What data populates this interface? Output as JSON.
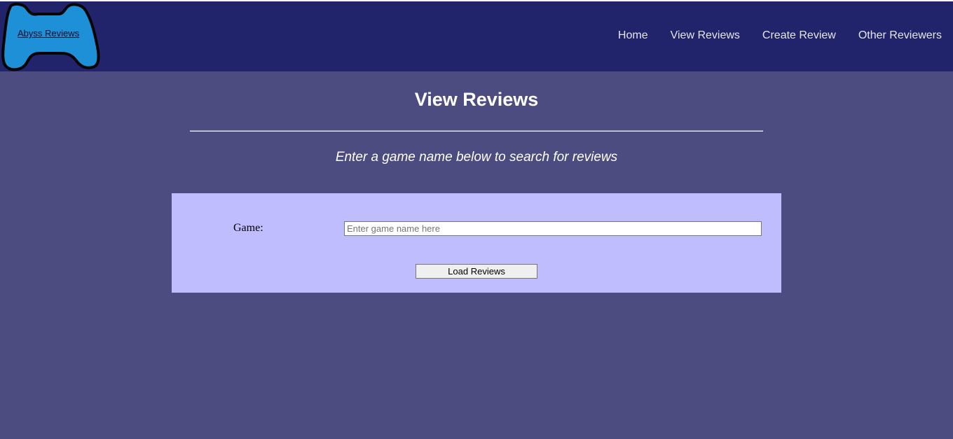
{
  "logo": {
    "text": "Abyss Reviews",
    "icon": "controller-logo-icon"
  },
  "nav": {
    "items": [
      {
        "label": "Home"
      },
      {
        "label": "View Reviews"
      },
      {
        "label": "Create Review"
      },
      {
        "label": "Other Reviewers"
      }
    ]
  },
  "main": {
    "title": "View Reviews",
    "subtitle": "Enter a game name below to search for reviews"
  },
  "search": {
    "game_label": "Game:",
    "game_value": "",
    "game_placeholder": "Enter game name here",
    "button_label": "Load Reviews"
  },
  "colors": {
    "header_bg": "#21236b",
    "page_bg": "#4c4c80",
    "panel_bg": "#c0bdfe",
    "logo_fill": "#1e90d8"
  }
}
